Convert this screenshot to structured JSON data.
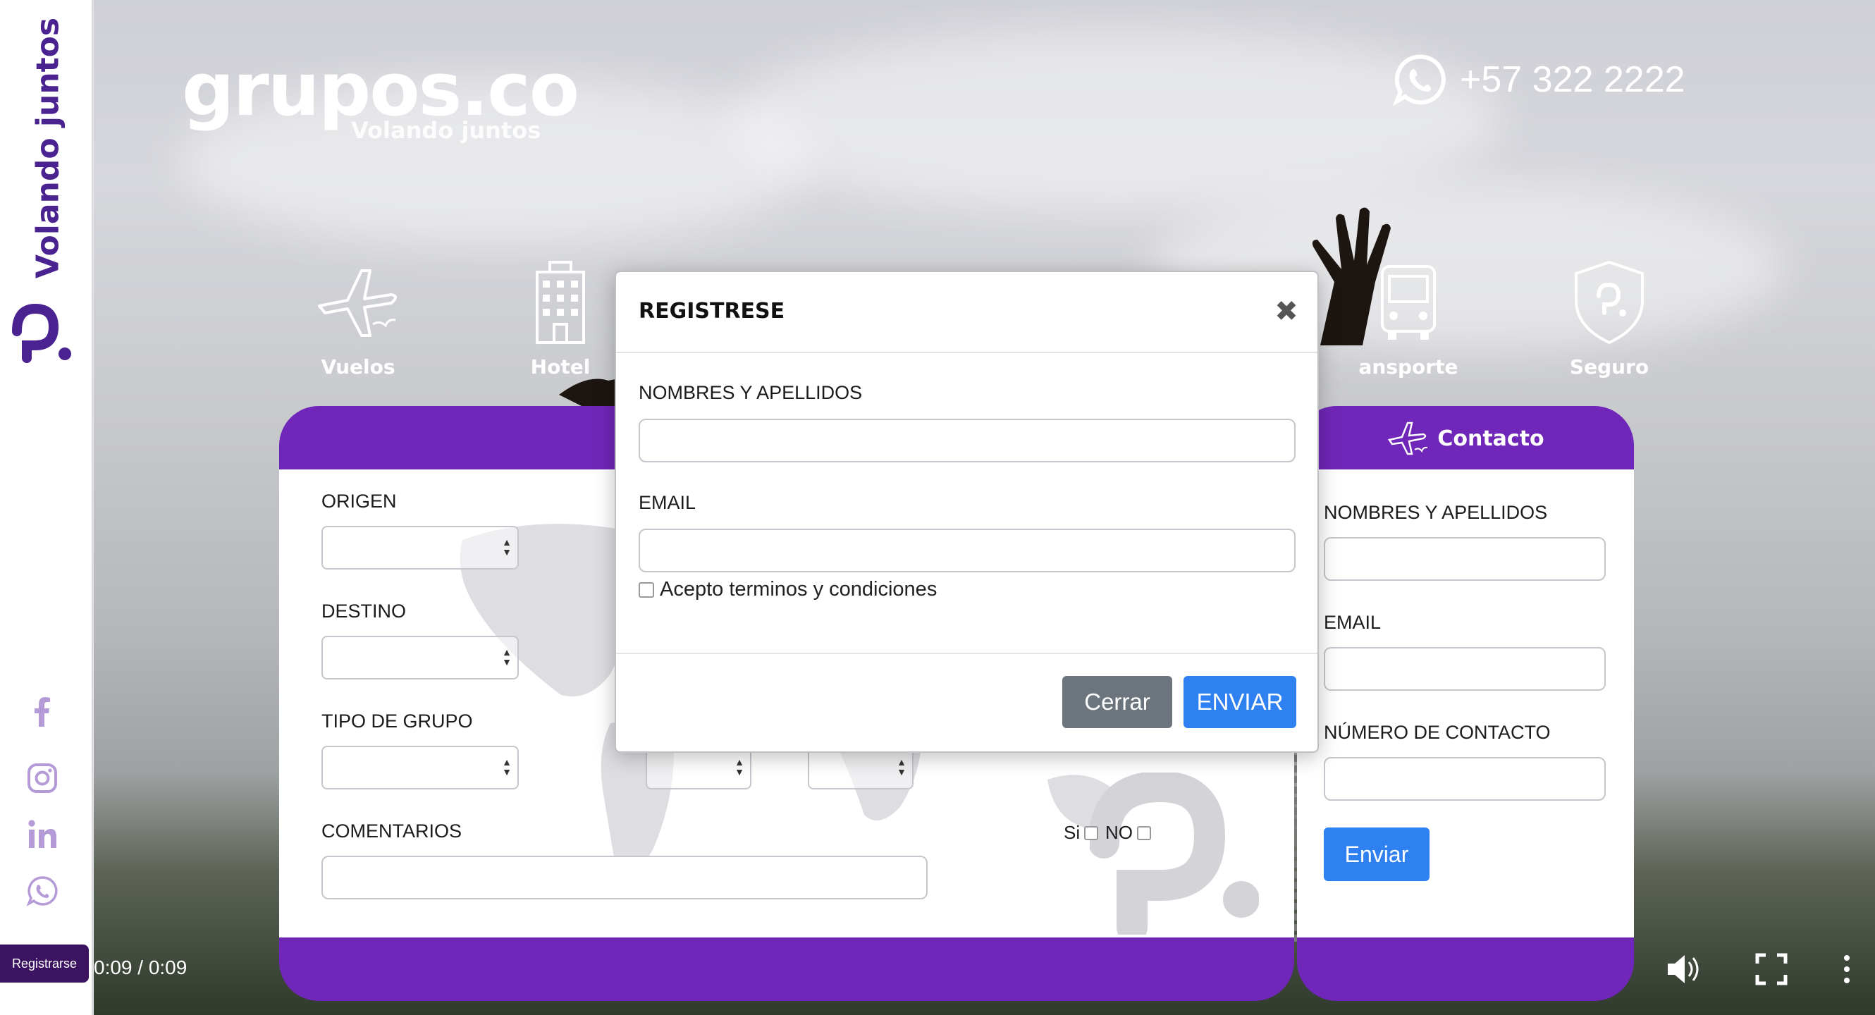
{
  "sidebar": {
    "brand_text": "Volando juntos",
    "social": [
      "facebook-icon",
      "instagram-icon",
      "linkedin-icon",
      "whatsapp-icon"
    ],
    "register_label": "Registrarse"
  },
  "hero": {
    "logo_word": "grupos.co",
    "logo_tagline": "Volando juntos",
    "phone": "+57 322 2222",
    "services": [
      {
        "label": "Vuelos",
        "icon": "airplane-icon"
      },
      {
        "label": "Hotel",
        "icon": "hotel-icon"
      },
      {
        "label": "ansporte",
        "icon": "bus-icon"
      },
      {
        "label": "Seguro",
        "icon": "shield-icon"
      }
    ]
  },
  "booking": {
    "origin_label": "ORIGEN",
    "destination_label": "DESTINO",
    "group_type_label": "TIPO DE GRUPO",
    "comments_label": "COMENTARIOS",
    "yes_label": "Si",
    "no_label": "NO"
  },
  "contact": {
    "title": "Contacto",
    "name_label": "NOMBRES Y APELLIDOS",
    "email_label": "EMAIL",
    "phone_label": "NÚMERO DE CONTACTO",
    "submit_label": "Enviar"
  },
  "video": {
    "time": "0:09 / 0:09"
  },
  "modal": {
    "title": "REGISTRESE",
    "close_glyph": "✖",
    "name_label": "NOMBRES Y APELLIDOS",
    "email_label": "EMAIL",
    "terms_label": "Acepto terminos y condiciones",
    "cancel_label": "Cerrar",
    "submit_label": "ENVIAR"
  },
  "colors": {
    "brand_purple": "#7026b8",
    "dark_purple": "#3b1361",
    "primary_blue": "#2f80f0",
    "secondary_gray": "#6c757d"
  }
}
